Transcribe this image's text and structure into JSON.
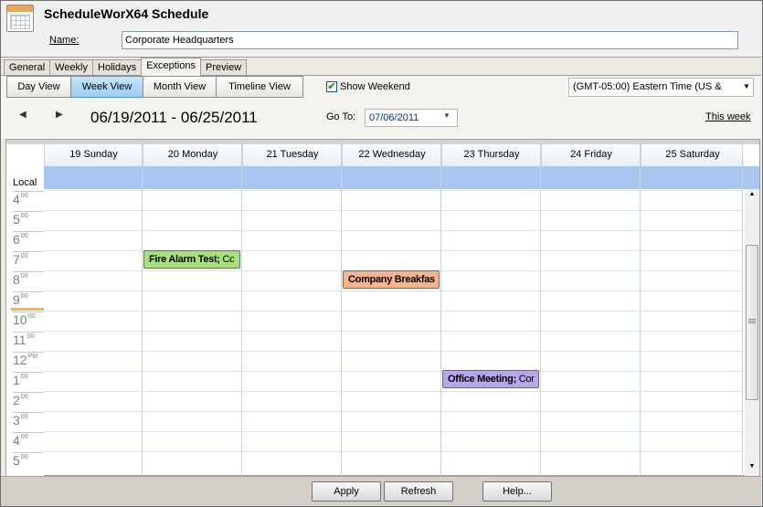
{
  "window": {
    "title": "ScheduleWorX64 Schedule"
  },
  "name": {
    "label": "Name:",
    "value": "Corporate Headquarters"
  },
  "tabs": [
    "General",
    "Weekly",
    "Holidays",
    "Exceptions",
    "Preview"
  ],
  "active_tab": "Exceptions",
  "views": [
    "Day View",
    "Week View",
    "Month View",
    "Timeline View"
  ],
  "active_view": "Week View",
  "show_weekend": {
    "label": "Show Weekend",
    "checked": true,
    "check_glyph": "✔"
  },
  "timezone": {
    "value": "(GMT-05:00) Eastern Time (US &"
  },
  "navigation": {
    "prev_glyph": "◀",
    "next_glyph": "▶",
    "date_range": "06/19/2011 - 06/25/2011"
  },
  "goto": {
    "label": "Go To:",
    "value": "07/06/2011"
  },
  "this_week": "This week",
  "local_label": "Local",
  "days": [
    "19 Sunday",
    "20 Monday",
    "21 Tuesday",
    "22 Wednesday",
    "23 Thursday",
    "24 Friday",
    "25 Saturday"
  ],
  "hours": [
    {
      "h": "4",
      "s": "00"
    },
    {
      "h": "5",
      "s": "00"
    },
    {
      "h": "6",
      "s": "00"
    },
    {
      "h": "7",
      "s": "00"
    },
    {
      "h": "8",
      "s": "00"
    },
    {
      "h": "9",
      "s": "00"
    },
    {
      "h": "10",
      "s": "00"
    },
    {
      "h": "11",
      "s": "00"
    },
    {
      "h": "12",
      "s": "PM"
    },
    {
      "h": "1",
      "s": "00"
    },
    {
      "h": "2",
      "s": "00"
    },
    {
      "h": "3",
      "s": "00"
    },
    {
      "h": "4",
      "s": "00"
    },
    {
      "h": "5",
      "s": "00"
    }
  ],
  "appointments": [
    {
      "title": "Fire Alarm Test;",
      "extra": " Cc",
      "day": "20 Monday",
      "start": "7:00",
      "color": "#a8e07a"
    },
    {
      "title": "Company Breakfas",
      "extra": "",
      "day": "22 Wednesday",
      "start": "8:00",
      "color": "#f8b48c"
    },
    {
      "title": "Office Meeting;",
      "extra": " Cor",
      "day": "23 Thursday",
      "start": "1:00",
      "color": "#b7a6ea"
    }
  ],
  "footer": {
    "apply": "Apply",
    "refresh": "Refresh",
    "help": "Help..."
  },
  "scroll": {
    "up": "▲",
    "down": "▼"
  },
  "dropdown_glyph": "▼"
}
